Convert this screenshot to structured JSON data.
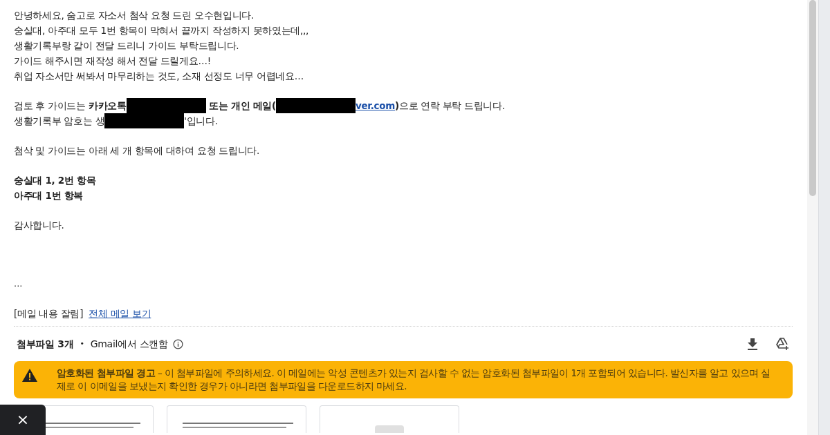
{
  "body_lines": [
    {
      "kind": "text",
      "text": "안녕하세요, 숨고로 자소서 첨삭 요청 드린 오수현입니다."
    },
    {
      "kind": "text",
      "text": "숭실대, 아주대 모두 1번 항목이 막혀서 끝까지 작성하지 못하였는데,,,"
    },
    {
      "kind": "text",
      "text": "생활기록부랑 같이 전달 드리니 가이드 부탁드립니다."
    },
    {
      "kind": "text",
      "text": "가이드 해주시면 재작성 해서 전달 드릴게요…!"
    },
    {
      "kind": "text",
      "text": "취업 자소서만 써봐서 마무리하는 것도, 소재 선정도 너무 어렵네요…"
    },
    {
      "kind": "blank"
    },
    {
      "kind": "mixed",
      "parts": [
        {
          "kind": "plain",
          "text": "검토 후 가이드는 "
        },
        {
          "kind": "bold",
          "text": "카카오톡"
        },
        {
          "kind": "redacted"
        },
        {
          "kind": "bold",
          "text": " 또는 개인 메일("
        },
        {
          "kind": "redacted"
        },
        {
          "kind": "link",
          "text": "ver.com"
        },
        {
          "kind": "bold",
          "text": ")"
        },
        {
          "kind": "plain",
          "text": "으로 연락 부탁 드립니다."
        }
      ]
    },
    {
      "kind": "mixed",
      "parts": [
        {
          "kind": "plain",
          "text": "생활기록부 암호는 생"
        },
        {
          "kind": "redacted"
        },
        {
          "kind": "plain",
          "text": "'입니다."
        }
      ]
    },
    {
      "kind": "blank"
    },
    {
      "kind": "text",
      "text": "첨삭 및 가이드는 아래 세 개 항목에 대하여 요청 드립니다."
    },
    {
      "kind": "blank"
    },
    {
      "kind": "bold",
      "text": "숭실대 1, 2번 항목"
    },
    {
      "kind": "bold",
      "text": "아주대 1번 항복"
    },
    {
      "kind": "blank"
    },
    {
      "kind": "text",
      "text": "감사합니다."
    }
  ],
  "ellipsis": "...",
  "clipped_notice": {
    "label": "[메일 내용 잘림]",
    "link": "전체 메일 보기"
  },
  "attachments": {
    "title": "첨부파일 3개",
    "separator": "•",
    "scanned": "Gmail에서 스캔함",
    "warning": {
      "title": "암호화된 첨부파일 경고",
      "text": " – 이 첨부파일에 주의하세요. 이 메일에는 악성 콘텐츠가 있는지 검사할 수 없는 암호화된 첨부파일이 1개 포함되어 있습니다. 발신자를 알고 있으며 실제로 이 이메일을 보냈는지 확인한 경우가 아니라면 첨부파일을 다운로드하지 마세요."
    },
    "files": [
      {
        "kind": "document"
      },
      {
        "kind": "document"
      },
      {
        "kind": "generic"
      }
    ]
  },
  "close_symbol": "×"
}
